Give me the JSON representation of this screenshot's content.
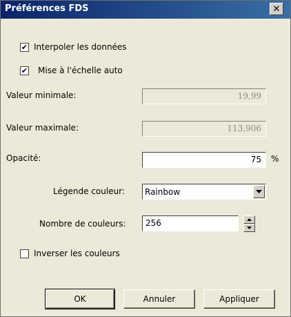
{
  "window": {
    "title": "Préférences FDS",
    "close_glyph": "✕"
  },
  "options": {
    "interpolate": {
      "label": "Interpoler les données",
      "checked": true
    },
    "autoscale": {
      "label": "Mise à l'échelle auto",
      "checked": true
    },
    "invert": {
      "label": "Inverser les couleurs",
      "checked": false
    }
  },
  "fields": {
    "min": {
      "label": "Valeur minimale:",
      "value": "19,99"
    },
    "max": {
      "label": "Valeur maximale:",
      "value": "113,906"
    },
    "opacity": {
      "label": "Opacité:",
      "value": "75",
      "unit": "%"
    },
    "legend": {
      "label": "Légende couleur:",
      "value": "Rainbow"
    },
    "num_colors": {
      "label": "Nombre de couleurs:",
      "value": "256"
    }
  },
  "buttons": {
    "ok": "OK",
    "cancel": "Annuler",
    "apply": "Appliquer"
  },
  "check_glyph": "✔"
}
